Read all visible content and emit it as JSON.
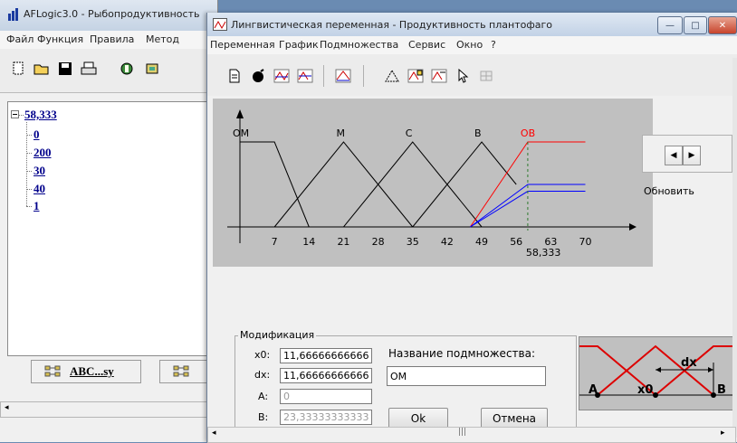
{
  "back_window": {
    "title": "AFLogic3.0 - Рыбопродуктивность",
    "menu": [
      "Файл",
      "Функция",
      "Правила",
      "Метод"
    ],
    "toolbar_icons": [
      "new-icon",
      "open-folder-icon",
      "save-icon",
      "print-icon",
      "tool-icon",
      "tool-icon"
    ],
    "tree": {
      "root": "58,333",
      "children": [
        "0",
        "200",
        "30",
        "40",
        "1"
      ]
    },
    "tabs": [
      {
        "label": "ABC...sy",
        "icon": "tree-icon"
      },
      {
        "label": "",
        "icon": "tree-icon"
      }
    ]
  },
  "front_window": {
    "title": "Лингвистическая переменная - Продуктивность плантофаго",
    "menu": [
      "Переменная",
      "График",
      "Подмножества",
      "Сервис",
      "Окно",
      "?"
    ],
    "toolbar_icons": [
      "document-icon",
      "bomb-icon",
      "chart-icon",
      "chart-icon",
      "chart-icon",
      "triangle-icon",
      "chart-edit-icon",
      "chart-edit-icon",
      "cursor-icon",
      "grid-icon"
    ],
    "window_buttons": {
      "minimize": "—",
      "maximize": "□",
      "close": "✕"
    }
  },
  "chart_data": {
    "type": "line",
    "series": [
      {
        "name": "ОМ",
        "x": [
          0,
          7,
          14
        ],
        "y": [
          1,
          1,
          0
        ],
        "color": "#000000"
      },
      {
        "name": "М",
        "x": [
          7,
          14,
          21,
          28,
          35
        ],
        "y": [
          0,
          0.5,
          1,
          0.5,
          0
        ],
        "color": "#000000"
      },
      {
        "name": "С",
        "x": [
          21,
          28,
          35,
          42,
          49
        ],
        "y": [
          0,
          0.5,
          1,
          0.5,
          0
        ],
        "color": "#000000"
      },
      {
        "name": "В",
        "x": [
          35,
          42,
          49,
          56
        ],
        "y": [
          0,
          0.5,
          1,
          0.5
        ],
        "color": "#000000"
      },
      {
        "name": "ОВ",
        "x": [
          46.67,
          58.333,
          70
        ],
        "y": [
          0,
          1,
          1
        ],
        "color": "#ff0000"
      }
    ],
    "extra_lines": [
      {
        "x": [
          46.67,
          58.333,
          70
        ],
        "y": [
          0,
          0.5,
          0.5
        ],
        "color": "#0000ff"
      },
      {
        "x": [
          46.67,
          58.333,
          70
        ],
        "y": [
          0,
          0.42,
          0.42
        ],
        "color": "#0000ff"
      }
    ],
    "marker_x": 58.333,
    "marker_label": "58,333",
    "x_ticks": [
      "7",
      "14",
      "21",
      "28",
      "35",
      "42",
      "49",
      "56",
      "63",
      "70"
    ],
    "x_tick_values": [
      7,
      14,
      21,
      28,
      35,
      42,
      49,
      56,
      63,
      70
    ],
    "xlim": [
      -1.5,
      82
    ],
    "ylim": [
      0,
      1.2
    ],
    "refresh_label": "Обновить"
  },
  "modification": {
    "legend": "Модификация",
    "x0_label": "x0:",
    "x0_value": "11,66666666666",
    "dx_label": "dx:",
    "dx_value": "11,66666666666",
    "a_label": "A:",
    "a_value": "0",
    "b_label": "B:",
    "b_value": "23,33333333333",
    "subset_label": "Название подмножества:",
    "subset_value": "ОМ",
    "ok_label": "Ok",
    "cancel_label": "Отмена"
  },
  "diagram": {
    "labels": {
      "a": "A",
      "x0": "x0",
      "dx": "dx",
      "b": "B"
    }
  }
}
